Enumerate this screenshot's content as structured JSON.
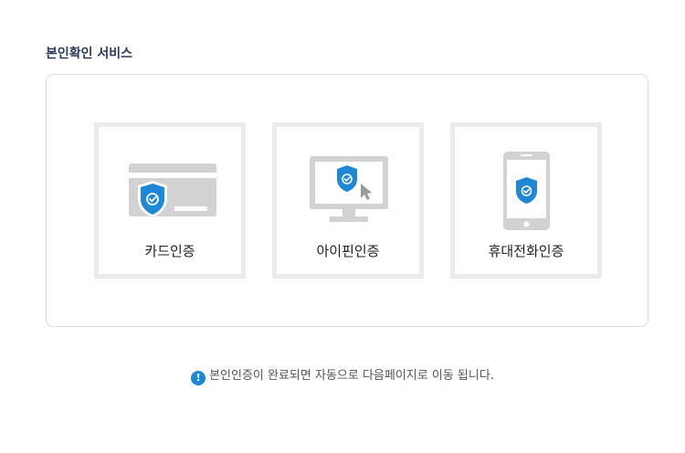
{
  "section": {
    "title": "본인확인 서비스"
  },
  "options": [
    {
      "label": "카드인증",
      "icon": "credit-card-shield-icon"
    },
    {
      "label": "아이핀인증",
      "icon": "monitor-shield-icon"
    },
    {
      "label": "휴대전화인증",
      "icon": "smartphone-shield-icon"
    }
  ],
  "notice": {
    "icon": "exclamation-icon",
    "icon_glyph": "!",
    "text": "본인인증이 완료되면 자동으로 다음페이지로 이동 됩니다."
  },
  "colors": {
    "accent": "#1e88d6",
    "title": "#2d3a5a",
    "option_border": "#ebebeb",
    "icon_gray": "#d2d2d2"
  }
}
